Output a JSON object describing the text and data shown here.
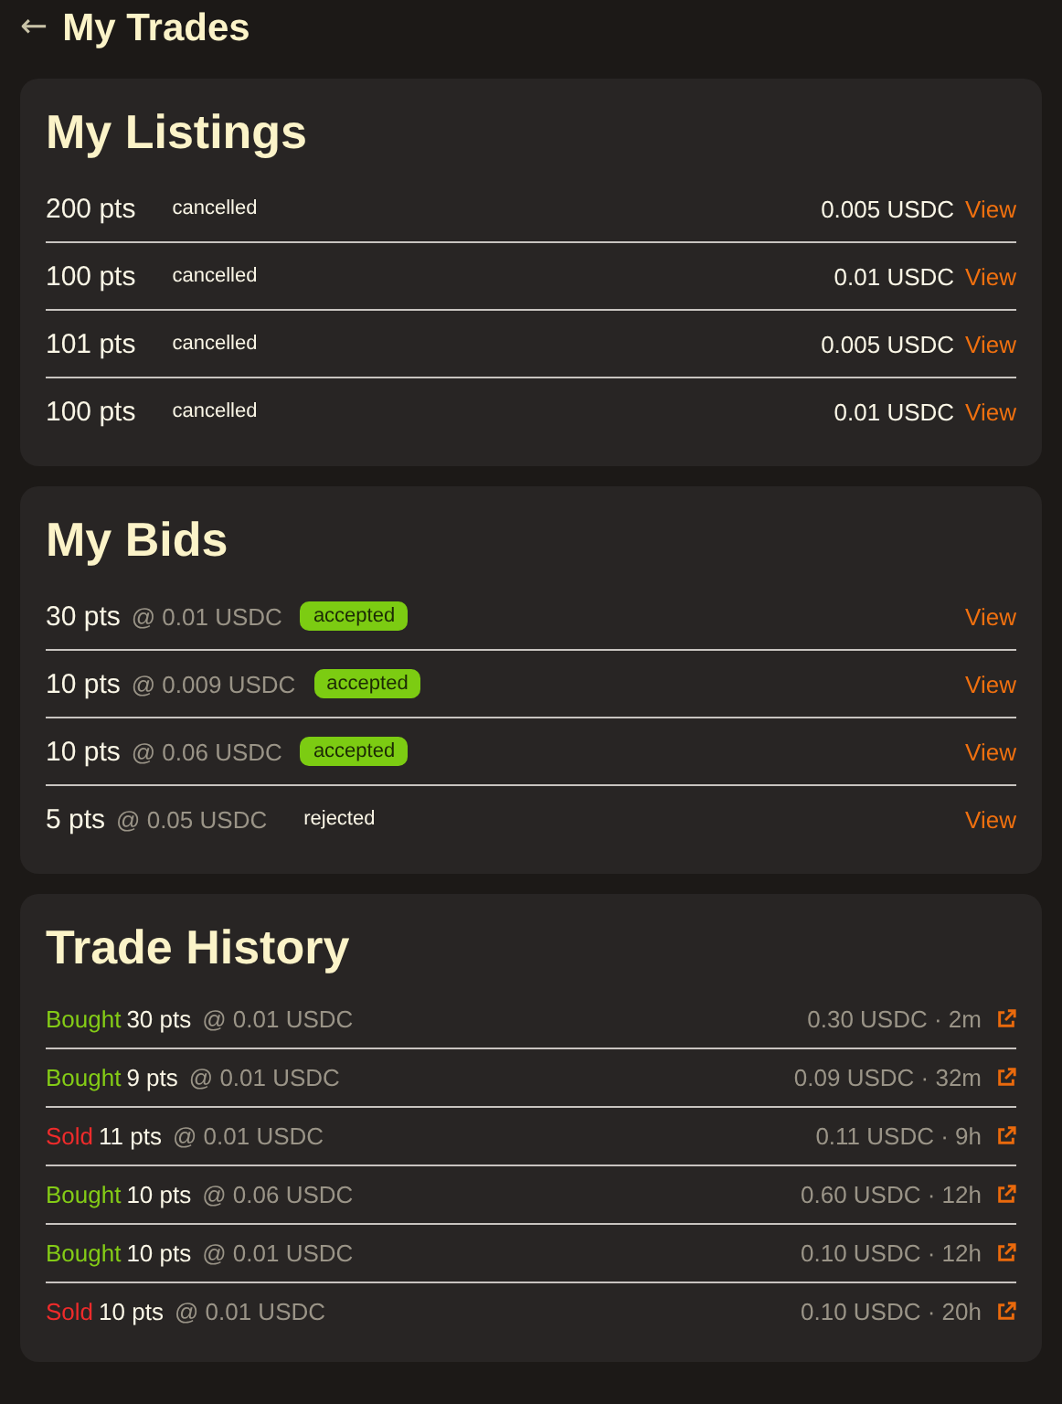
{
  "header": {
    "back": "←",
    "title": "My Trades"
  },
  "listings": {
    "title": "My Listings",
    "rows": [
      {
        "amount": "200 pts",
        "status": "cancelled",
        "price": "0.005 USDC",
        "link": "View"
      },
      {
        "amount": "100 pts",
        "status": "cancelled",
        "price": "0.01 USDC",
        "link": "View"
      },
      {
        "amount": "101 pts",
        "status": "cancelled",
        "price": "0.005 USDC",
        "link": "View"
      },
      {
        "amount": "100 pts",
        "status": "cancelled",
        "price": "0.01 USDC",
        "link": "View"
      }
    ]
  },
  "bids": {
    "title": "My Bids",
    "rows": [
      {
        "amount": "30 pts",
        "price": "@ 0.01 USDC",
        "kind": "badge",
        "status": "accepted",
        "link": "View"
      },
      {
        "amount": "10 pts",
        "price": "@ 0.009 USDC",
        "kind": "badge",
        "status": "accepted",
        "link": "View"
      },
      {
        "amount": "10 pts",
        "price": "@ 0.06 USDC",
        "kind": "badge",
        "status": "accepted",
        "link": "View"
      },
      {
        "amount": "5 pts",
        "price": "@ 0.05 USDC",
        "kind": "plain",
        "status": "rejected",
        "link": "View"
      }
    ]
  },
  "history": {
    "title": "Trade History",
    "rows": [
      {
        "kind": "buy",
        "action": "Bought",
        "amount": "30 pts",
        "price": "@ 0.01 USDC",
        "total": "0.30 USDC · 2m"
      },
      {
        "kind": "buy",
        "action": "Bought",
        "amount": "9 pts",
        "price": "@ 0.01 USDC",
        "total": "0.09 USDC · 32m"
      },
      {
        "kind": "sell",
        "action": "Sold",
        "amount": "11 pts",
        "price": "@ 0.01 USDC",
        "total": "0.11 USDC · 9h"
      },
      {
        "kind": "buy",
        "action": "Bought",
        "amount": "10 pts",
        "price": "@ 0.06 USDC",
        "total": "0.60 USDC · 12h"
      },
      {
        "kind": "buy",
        "action": "Bought",
        "amount": "10 pts",
        "price": "@ 0.01 USDC",
        "total": "0.10 USDC · 12h"
      },
      {
        "kind": "sell",
        "action": "Sold",
        "amount": "10 pts",
        "price": "@ 0.01 USDC",
        "total": "0.10 USDC · 20h"
      }
    ]
  }
}
